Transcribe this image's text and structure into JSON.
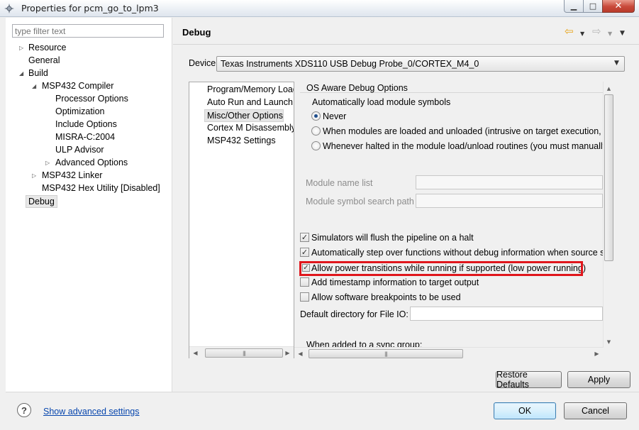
{
  "window": {
    "title": "Properties for pcm_go_to_lpm3",
    "minimize": "▁",
    "maximize": "□",
    "close": "✕"
  },
  "filter": {
    "placeholder": "type filter text"
  },
  "tree": {
    "resource": "Resource",
    "general": "General",
    "build": "Build",
    "compiler": "MSP432 Compiler",
    "processor_options": "Processor Options",
    "optimization": "Optimization",
    "include_options": "Include Options",
    "misra": "MISRA-C:2004",
    "ulp_advisor": "ULP Advisor",
    "advanced_options": "Advanced Options",
    "linker": "MSP432 Linker",
    "hex_utility": "MSP432 Hex Utility  [Disabled]",
    "debug": "Debug"
  },
  "page": {
    "title": "Debug"
  },
  "device": {
    "label": "Device",
    "value": "Texas Instruments XDS110 USB Debug Probe_0/CORTEX_M4_0"
  },
  "categories": [
    "Program/Memory Load",
    "Auto Run and Launch Options",
    "Misc/Other Options",
    "Cortex M Disassembly Style",
    "MSP432 Settings"
  ],
  "options": {
    "os_aware_title": "OS Aware Debug Options",
    "auto_load_title": "Automatically load module symbols",
    "radio_never": "Never",
    "radio_when_loaded": "When modules are loaded and unloaded (intrusive on target execution, and",
    "radio_whenever_halted": "Whenever halted in the module load/unload routines (you must manually s",
    "module_name_list": "Module name list",
    "module_symbol_path": "Module symbol search path",
    "chk_simulators_flush": "Simulators will flush the pipeline on a halt",
    "chk_auto_step": "Automatically step over functions without debug information when source ste",
    "chk_power_transitions": "Allow power transitions while running if supported (low power running)",
    "chk_timestamp": "Add timestamp information to target output",
    "chk_sw_breakpoints": "Allow software breakpoints to be used",
    "default_dir_label": "Default directory for File IO:",
    "sync_group_label": "When added to a sync group:"
  },
  "buttons": {
    "restore_defaults": "Restore Defaults",
    "apply": "Apply",
    "ok": "OK",
    "cancel": "Cancel"
  },
  "footer": {
    "help": "?",
    "advanced_link": "Show advanced settings"
  },
  "colors": {
    "highlight": "#e0161c",
    "nav_back": "#e8a317",
    "link": "#0645ad"
  }
}
